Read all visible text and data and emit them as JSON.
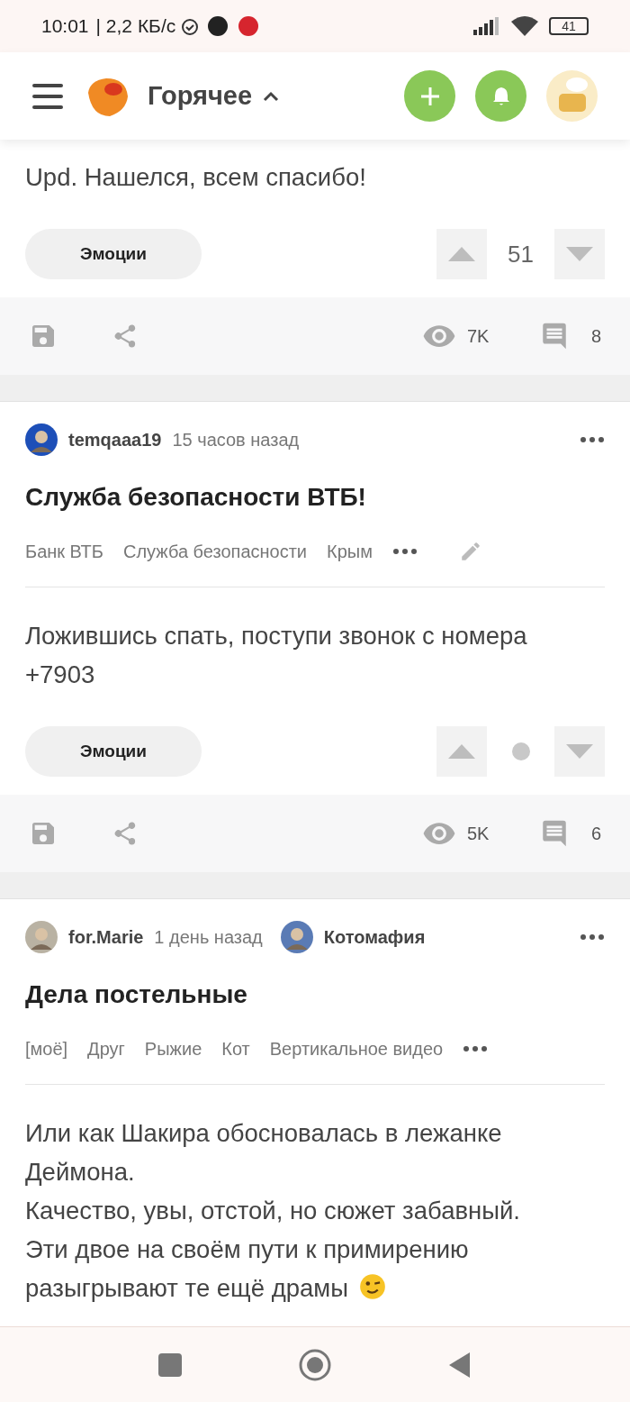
{
  "status_bar": {
    "time": "10:01",
    "speed": "| 2,2 КБ/с",
    "battery": "41"
  },
  "header": {
    "title": "Горячее"
  },
  "posts": [
    {
      "kind": "partial",
      "body": [
        "Upd. Нашелся, всем спасибо!"
      ],
      "emotions": "Эмоции",
      "rating_hidden": false,
      "rating": "51",
      "views": "7K",
      "comments": "8"
    },
    {
      "kind": "full",
      "author": "temqaaa19",
      "time": "15 часов назад",
      "title": "Служба безопасности ВТБ!",
      "tags": [
        "Банк ВТБ",
        "Служба безопасности",
        "Крым"
      ],
      "editable": true,
      "body": [
        "Ложившись спать, поступи звонок с номера +7903"
      ],
      "emotions": "Эмоции",
      "rating_hidden": true,
      "views": "5K",
      "comments": "6"
    },
    {
      "kind": "full",
      "author": "for.Marie",
      "time": "1 день назад",
      "community": "Котомафия",
      "title": "Дела постельные",
      "tags": [
        "[моё]",
        "Друг",
        "Рыжие",
        "Кот",
        "Вертикальное видео"
      ],
      "editable": false,
      "body": [
        "Или как Шакира обосновалась в лежанке Деймона.",
        "Качество, увы, отстой, но сюжет забавный. Эти двое на своём пути к примирению разыгрывают те ещё драмы"
      ],
      "wink": true
    }
  ]
}
